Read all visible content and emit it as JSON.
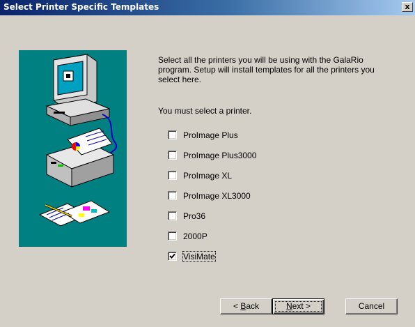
{
  "window": {
    "title": "Select Printer Specific Templates",
    "close_glyph": "x"
  },
  "content": {
    "intro": "Select all the printers you will be using with the GalaRio program. Setup will install templates for all the printers you select here.",
    "required_note": "You must select a printer."
  },
  "printers": [
    {
      "label": "ProImage Plus",
      "checked": false
    },
    {
      "label": "ProImage Plus3000",
      "checked": false
    },
    {
      "label": "ProImage XL",
      "checked": false
    },
    {
      "label": "ProImage XL3000",
      "checked": false
    },
    {
      "label": "Pro36",
      "checked": false
    },
    {
      "label": "2000P",
      "checked": false
    },
    {
      "label": "VisiMate",
      "checked": true
    }
  ],
  "buttons": {
    "back": {
      "prefix": "< ",
      "mnemonic": "B",
      "rest": "ack"
    },
    "next": {
      "mnemonic": "N",
      "rest": "ext >"
    },
    "cancel": "Cancel"
  },
  "colors": {
    "title_active": "#0a246a",
    "title_gradient_end": "#a6caf0",
    "illustration_bg": "#008080",
    "face": "#d4d0c8"
  },
  "icons": {
    "illustration": "computer-printer-illustration",
    "check": "checkmark-icon"
  }
}
